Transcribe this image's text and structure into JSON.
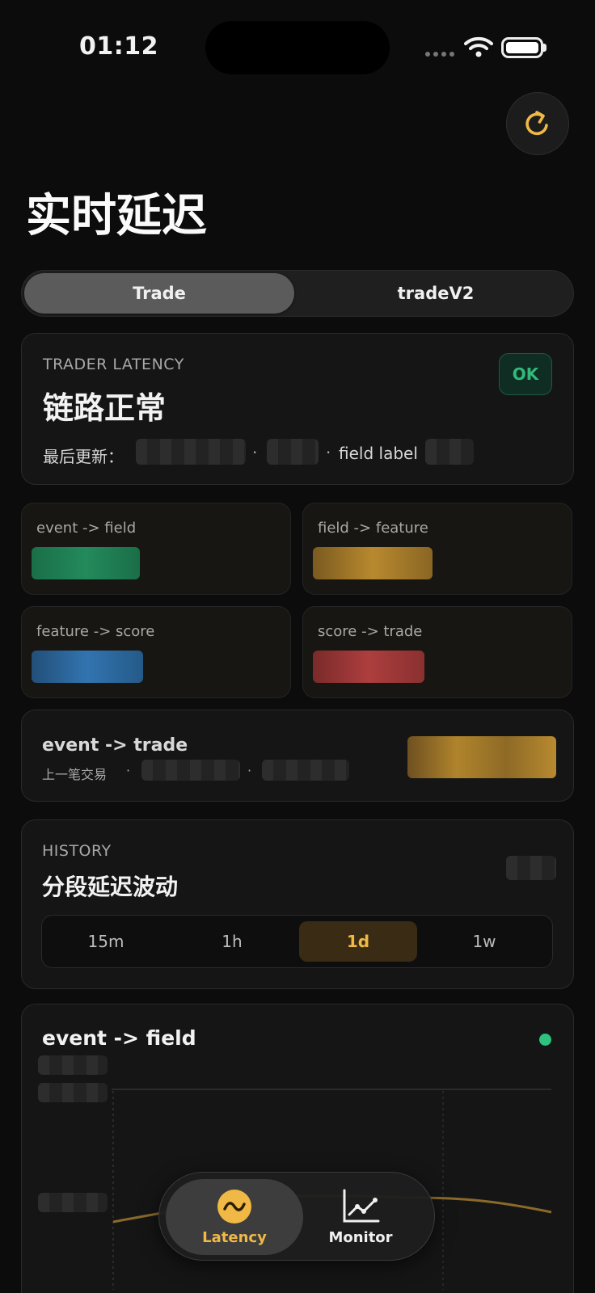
{
  "status_bar": {
    "time": "01:12"
  },
  "page_title": "实时延迟",
  "segments": [
    "Trade",
    "tradeV2"
  ],
  "selected_segment": "Trade",
  "status_card": {
    "eyebrow": "TRADER LATENCY",
    "title": "链路正常",
    "badge": "OK",
    "updated_label": "最后更新：",
    "separator": "·",
    "field_label": "field label"
  },
  "metrics": [
    {
      "label": "event -> field",
      "color": "#1f8a5a"
    },
    {
      "label": "field -> feature",
      "color": "#b8892e"
    },
    {
      "label": "feature -> score",
      "color": "#2f6ea8"
    },
    {
      "label": "score -> trade",
      "color": "#a83c3c"
    }
  ],
  "total_card": {
    "title": "event -> trade",
    "sub_label": "上一笔交易",
    "separator": "·"
  },
  "history_card": {
    "eyebrow": "HISTORY",
    "title": "分段延迟波动",
    "timeframes": [
      "15m",
      "1h",
      "1d",
      "1w"
    ],
    "selected_timeframe": "1d"
  },
  "chart_card": {
    "title": "event -> field",
    "status_color": "#2ec27e"
  },
  "tabbar": {
    "tabs": [
      {
        "label": "Latency",
        "icon": "latency-wave-icon",
        "active": true
      },
      {
        "label": "Monitor",
        "icon": "line-chart-icon",
        "active": false
      }
    ]
  },
  "colors": {
    "accent": "#f0b845",
    "ok": "#32b87a",
    "background": "#0c0c0c"
  }
}
